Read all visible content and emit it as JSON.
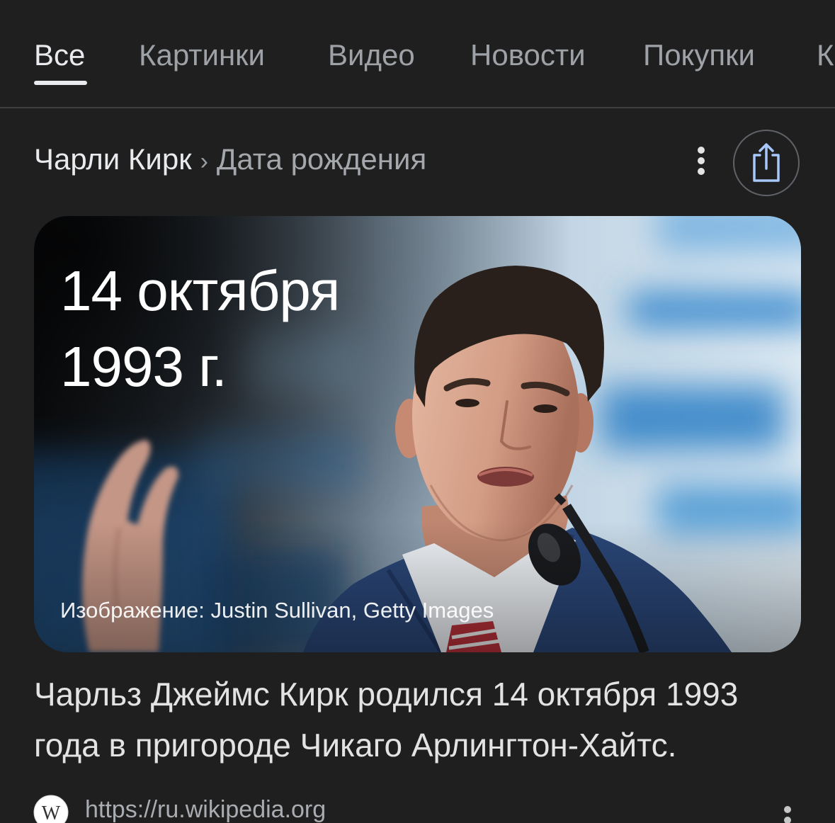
{
  "tabs": [
    {
      "label": "Все",
      "active": true
    },
    {
      "label": "Картинки",
      "active": false
    },
    {
      "label": "Видео",
      "active": false
    },
    {
      "label": "Новости",
      "active": false
    },
    {
      "label": "Покупки",
      "active": false
    },
    {
      "label": "К",
      "active": false
    }
  ],
  "breadcrumb": {
    "entity": "Чарли Кирк",
    "separator": "›",
    "attribute": "Дата рождения"
  },
  "header_actions": {
    "more_icon": "more-vert-icon",
    "share_icon": "share-icon"
  },
  "answer_card": {
    "date": "14 октября 1993 г.",
    "image_credit": "Изображение: Justin Sullivan, Getty Images"
  },
  "description": {
    "lines": [
      "Чарльз Джеймс Кирк родился 14 октября 1993",
      "года в пригороде Чикаго Арлингтон-Хайтс."
    ]
  },
  "source": {
    "favicon_letter": "W",
    "favicon_icon": "wikipedia-icon",
    "url": "https://ru.wikipedia.org",
    "more_icon": "more-vert-icon"
  },
  "colors": {
    "background": "#1f1f1f",
    "text_primary": "#e8eaed",
    "text_secondary": "#9aa0a6",
    "accent": "#a8c7fa",
    "divider": "#3c4043"
  }
}
